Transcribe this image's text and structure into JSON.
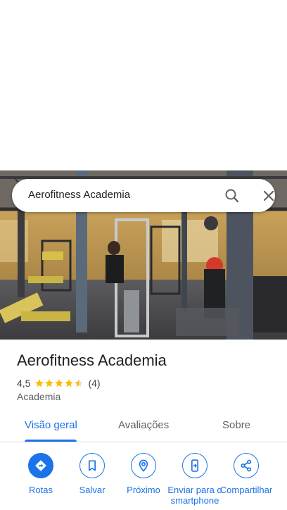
{
  "search": {
    "query": "Aerofitness Academia",
    "search_icon": "search-icon",
    "close_icon": "close-icon"
  },
  "photo": {
    "description_icon": "gym-photo"
  },
  "place": {
    "name": "Aerofitness Academia",
    "rating": "4,5",
    "rating_value": 4.5,
    "star_count": 5,
    "reviews": "(4)",
    "category": "Academia"
  },
  "tabs": [
    {
      "label": "Visão geral",
      "active": true
    },
    {
      "label": "Avaliações",
      "active": false
    },
    {
      "label": "Sobre",
      "active": false
    }
  ],
  "actions": [
    {
      "label": "Rotas",
      "icon": "directions-icon"
    },
    {
      "label": "Salvar",
      "icon": "bookmark-icon"
    },
    {
      "label": "Próximo",
      "icon": "nearby-icon"
    },
    {
      "label": "Enviar para o smartphone",
      "icon": "send-to-phone-icon"
    },
    {
      "label": "Compartilhar",
      "icon": "share-icon"
    }
  ],
  "colors": {
    "accent": "#1a73e8",
    "star": "#fbbc04",
    "star_empty": "#dadce0",
    "text_primary": "#202124",
    "text_secondary": "#5f6368"
  }
}
